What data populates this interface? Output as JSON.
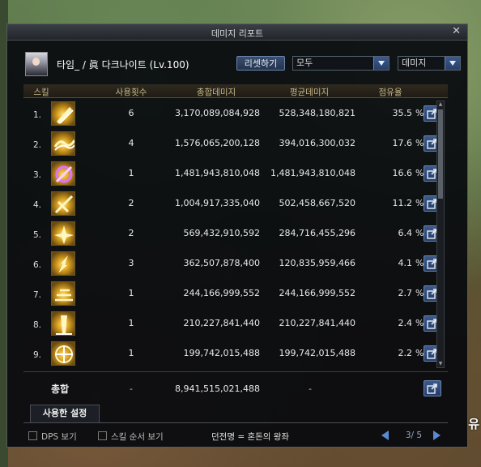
{
  "window": {
    "title": "데미지 리포트",
    "close_glyph": "✕"
  },
  "header": {
    "character": "타임_ / 眞 다크나이트 (Lv.100)",
    "reset_label": "리셋하기",
    "filter1_value": "모두",
    "filter2_value": "데미지"
  },
  "columns": {
    "skill": "스킬",
    "count": "사용횟수",
    "total": "총합데미지",
    "avg": "평균데미지",
    "share": "점유율"
  },
  "rows": [
    {
      "rank": "1.",
      "count": "6",
      "total": "3,170,089,084,928",
      "avg": "528,348,180,821",
      "pct": "35.5",
      "icon": "skill-slash-icon"
    },
    {
      "rank": "2.",
      "count": "4",
      "total": "1,576,065,200,128",
      "avg": "394,016,300,032",
      "pct": "17.6",
      "icon": "skill-wave-icon"
    },
    {
      "rank": "3.",
      "count": "1",
      "total": "1,481,943,810,048",
      "avg": "1,481,943,810,048",
      "pct": "16.6",
      "icon": "skill-vortex-icon"
    },
    {
      "rank": "4.",
      "count": "2",
      "total": "1,004,917,335,040",
      "avg": "502,458,667,520",
      "pct": "11.2",
      "icon": "skill-cross-slash-icon"
    },
    {
      "rank": "5.",
      "count": "2",
      "total": "569,432,910,592",
      "avg": "284,716,455,296",
      "pct": "6.4",
      "icon": "skill-burst-icon"
    },
    {
      "rank": "6.",
      "count": "3",
      "total": "362,507,878,400",
      "avg": "120,835,959,466",
      "pct": "4.1",
      "icon": "skill-strike-icon"
    },
    {
      "rank": "7.",
      "count": "1",
      "total": "244,166,999,552",
      "avg": "244,166,999,552",
      "pct": "2.7",
      "icon": "skill-dash-icon"
    },
    {
      "rank": "8.",
      "count": "1",
      "total": "210,227,841,440",
      "avg": "210,227,841,440",
      "pct": "2.4",
      "icon": "skill-pillar-icon"
    },
    {
      "rank": "9.",
      "count": "1",
      "total": "199,742,015,488",
      "avg": "199,742,015,488",
      "pct": "2.2",
      "icon": "skill-aura-icon"
    }
  ],
  "pct_sign": "%",
  "summary": {
    "label": "총합",
    "count": "-",
    "total": "8,941,515,021,488",
    "avg": "-"
  },
  "tab": {
    "label": "사용한 설정"
  },
  "footer": {
    "dps_label": "DPS 보기",
    "order_label": "스킬 순서 보기",
    "dungeon": "던전명 = 혼돈의 왕좌",
    "page": "3/ 5"
  },
  "background_text": "유"
}
